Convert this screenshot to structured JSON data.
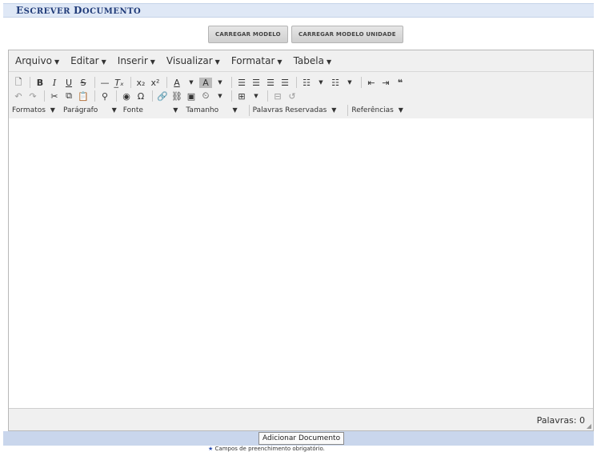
{
  "header": {
    "title_first": "E",
    "title_rest": "SCREVER ",
    "title_second": "D",
    "title_second_rest": "OCUMENTO"
  },
  "buttons": {
    "load_model": "CARREGAR MODELO",
    "load_model_unit": "CARREGAR MODELO UNIDADE"
  },
  "menus": [
    {
      "label": "Arquivo"
    },
    {
      "label": "Editar"
    },
    {
      "label": "Inserir"
    },
    {
      "label": "Visualizar"
    },
    {
      "label": "Formatar"
    },
    {
      "label": "Tabela"
    }
  ],
  "dropdowns": {
    "formats": "Formatos",
    "paragraph": "Parágrafo",
    "font": "Fonte",
    "size": "Tamanho",
    "reserved": "Palavras Reservadas",
    "references": "Referências"
  },
  "status": {
    "words": "Palavras: 0"
  },
  "actions": {
    "add_document": "Adicionar Documento"
  },
  "footer": {
    "required_note": "Campos de preenchimento obrigatório."
  }
}
